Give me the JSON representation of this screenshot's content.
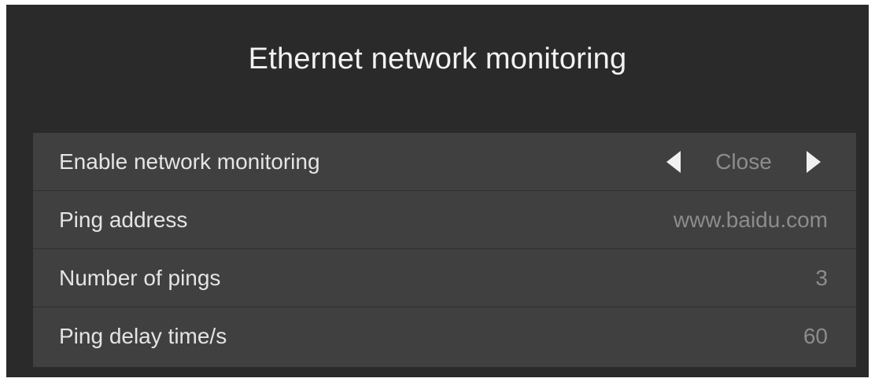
{
  "screen": {
    "title": "Ethernet network monitoring"
  },
  "settings": {
    "enable_monitoring": {
      "label": "Enable network monitoring",
      "value": "Close",
      "prev_icon": "arrow-left-icon",
      "next_icon": "arrow-right-icon"
    },
    "ping_address": {
      "label": "Ping address",
      "value": "www.baidu.com"
    },
    "ping_count": {
      "label": "Number of pings",
      "value": "3"
    },
    "ping_delay": {
      "label": "Ping delay time/s",
      "value": "60"
    }
  },
  "colors": {
    "background": "#2a2a2a",
    "panel": "#404040",
    "label_text": "#e4e4e4",
    "value_text": "#8c8c8c"
  }
}
